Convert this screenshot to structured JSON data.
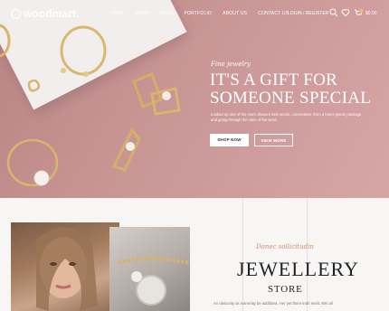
{
  "header": {
    "logo": "woodmart.",
    "nav": [
      "HOME",
      "SHOP",
      "BLOG",
      "PORTFOLIO",
      "ABOUT US",
      "CONTACT US"
    ],
    "login": "LOGIN / REGISTER",
    "cart_count": "0",
    "cart_total": "$0.00"
  },
  "hero": {
    "kicker": "Fine jewelry",
    "title_line1": "IT'S A GIFT FOR",
    "title_line2": "SOMEONE SPECIAL",
    "description": "Looked up one of the more obscure latin words, consectetur, from a lorem ipsum passage, and going through the cites of the word.",
    "shop_button": "SHOP NOW",
    "more_button": "VIEW MORE"
  },
  "feature": {
    "subtitle": "Donec sollicitudin",
    "title": "JEWELLERY",
    "title_sub": "STORE",
    "paragraph": "An obscurity as extremity be additions. Her yet there truth merit. Mrs all"
  },
  "colors": {
    "hero_bg": "#c48f8f",
    "accent": "#d08d6a"
  }
}
